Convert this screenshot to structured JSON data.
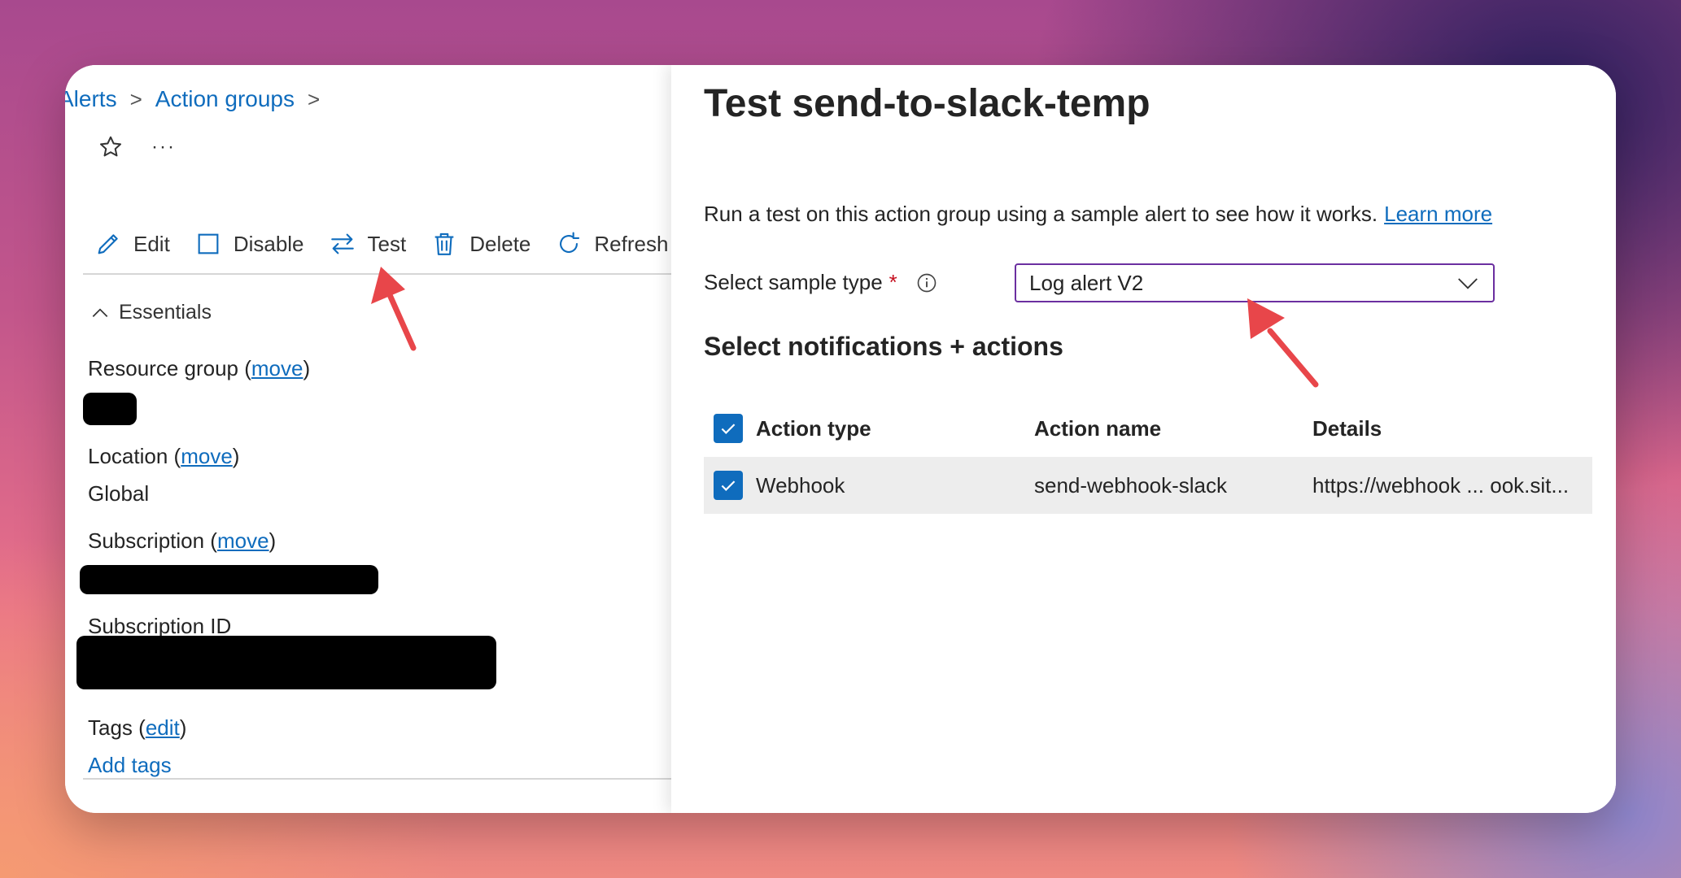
{
  "breadcrumb": {
    "items": [
      "Alerts",
      "Action groups"
    ]
  },
  "toolbar": {
    "edit": "Edit",
    "disable": "Disable",
    "test": "Test",
    "delete": "Delete",
    "refresh": "Refresh"
  },
  "overflow_menu": "···",
  "essentials": {
    "heading": "Essentials",
    "resource_group_label": "Resource group",
    "location_label": "Location",
    "location_value": "Global",
    "subscription_label": "Subscription",
    "subscription_id_label": "Subscription ID",
    "tags_label": "Tags",
    "move_link": "move",
    "edit_link": "edit",
    "add_tags": "Add tags"
  },
  "panel": {
    "title": "Test send-to-slack-temp",
    "description": "Run a test on this action group using a sample alert to see how it works.",
    "learn_more": "Learn more",
    "sample_type_label": "Select sample type",
    "required_mark": "*",
    "sample_type_value": "Log alert V2",
    "notifications_heading": "Select notifications + actions",
    "table": {
      "headers": [
        "Action type",
        "Action name",
        "Details"
      ],
      "rows": [
        {
          "type": "Webhook",
          "name": "send-webhook-slack",
          "details": "https://webhook ... ook.sit..."
        }
      ]
    }
  },
  "colors": {
    "link": "#0f6cbd",
    "checkbox": "#0f6cbd",
    "select_border": "#6b2fa0",
    "annotation_arrow": "#e8464a"
  }
}
